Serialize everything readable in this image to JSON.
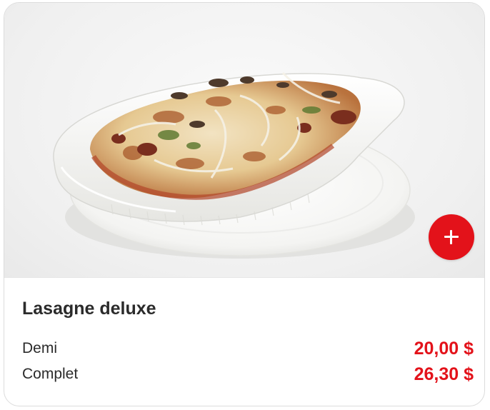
{
  "product": {
    "title": "Lasagne deluxe",
    "image": {
      "alt": "lasagna-dish-photo"
    },
    "add_button": {
      "icon": "plus-icon"
    },
    "prices": [
      {
        "label": "Demi",
        "price": "20,00 $"
      },
      {
        "label": "Complet",
        "price": "26,30 $"
      }
    ]
  },
  "colors": {
    "accent": "#e3121a",
    "text": "#2b2b2b",
    "border": "#dcdcdc"
  }
}
